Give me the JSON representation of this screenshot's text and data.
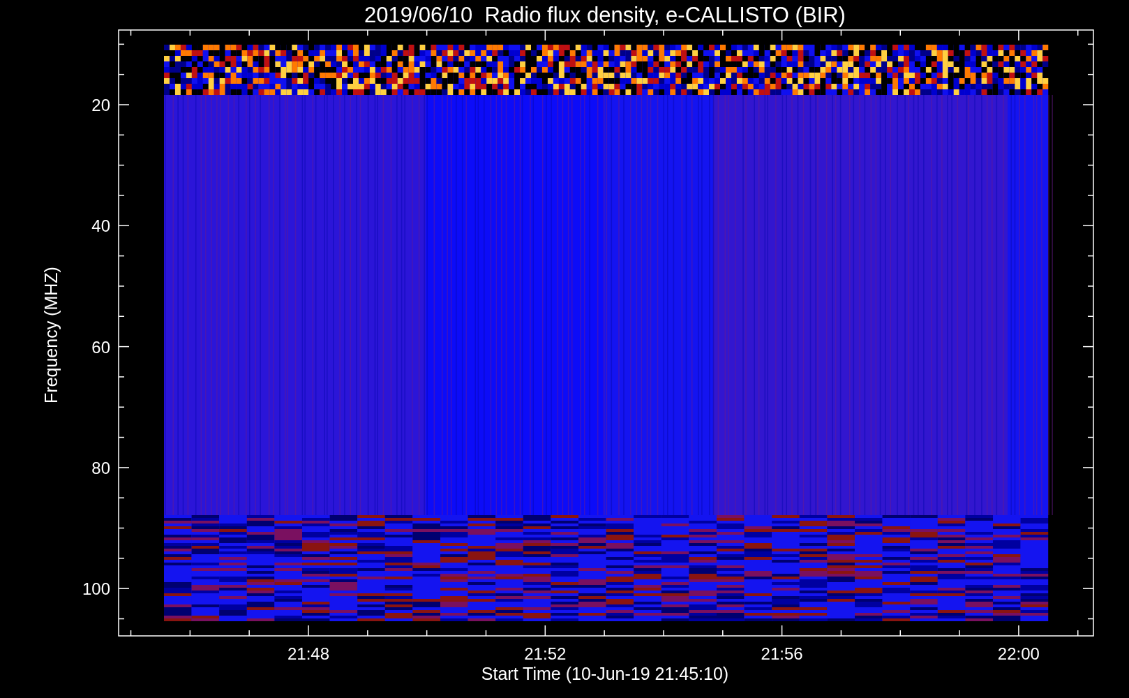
{
  "title": "2019/06/10  Radio flux density, e-CALLISTO (BIR)",
  "y_axis": {
    "label": "Frequency (MHZ)",
    "ticks": [
      "20",
      "40",
      "60",
      "80",
      "100"
    ]
  },
  "x_axis": {
    "label": "Start Time (10-Jun-19 21:45:10)",
    "ticks": [
      "21:48",
      "21:52",
      "21:56",
      "22:00"
    ]
  }
}
